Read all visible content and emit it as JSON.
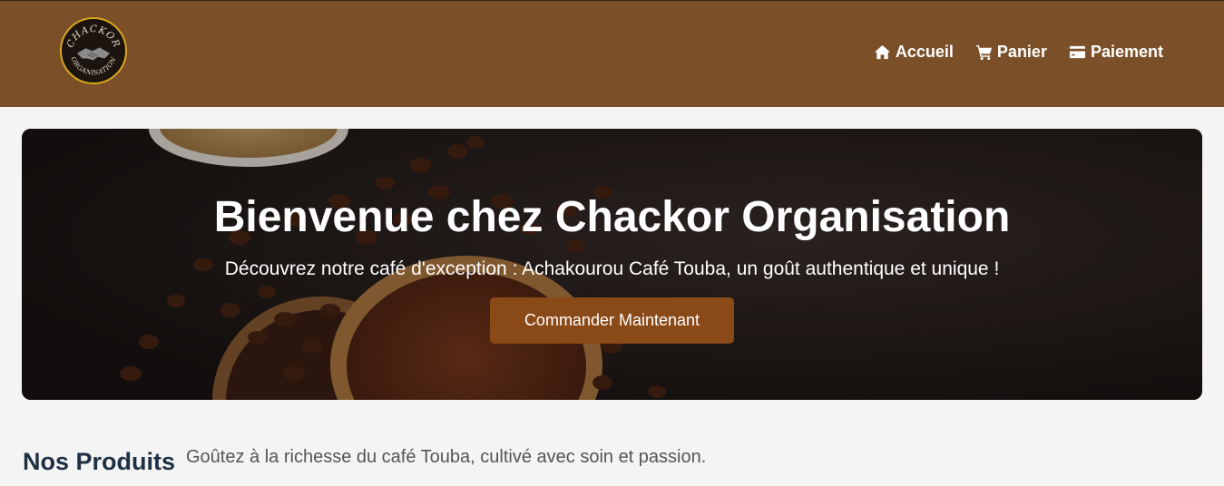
{
  "brand": {
    "logo_text_top": "CHACKOR",
    "logo_text_bottom": "ORGANISATION"
  },
  "nav": {
    "items": [
      {
        "label": "Accueil",
        "icon": "home-icon"
      },
      {
        "label": "Panier",
        "icon": "cart-icon"
      },
      {
        "label": "Paiement",
        "icon": "credit-card-icon"
      }
    ]
  },
  "hero": {
    "title": "Bienvenue chez Chackor Organisation",
    "subtitle": "Découvrez notre café d'exception : Achakourou Café Touba, un goût authentique et unique !",
    "cta_label": "Commander Maintenant"
  },
  "products": {
    "title": "Nos Produits",
    "description": "Goûtez à la richesse du café Touba, cultivé avec soin et passion."
  },
  "colors": {
    "header_bg": "#7b5029",
    "button_bg": "#8a4a18",
    "page_bg": "#f4f4f4",
    "heading": "#1f2f44"
  }
}
